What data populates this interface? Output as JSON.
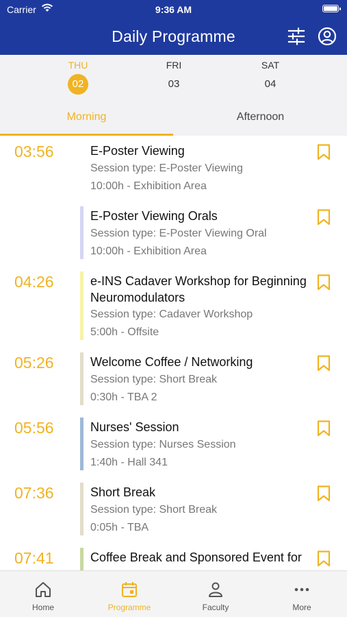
{
  "status_bar": {
    "carrier": "Carrier",
    "time": "9:36 AM"
  },
  "header": {
    "title": "Daily Programme",
    "filter_icon": "sliders-icon",
    "profile_icon": "user-circle-icon"
  },
  "colors": {
    "header": "#1f3a9e",
    "accent": "#f0b323",
    "grey_bg": "#f2f2f4"
  },
  "days": [
    {
      "name": "THU",
      "number": "02",
      "active": true
    },
    {
      "name": "FRI",
      "number": "03",
      "active": false
    },
    {
      "name": "SAT",
      "number": "04",
      "active": false
    }
  ],
  "tabs": [
    {
      "label": "Morning",
      "active": true
    },
    {
      "label": "Afternoon",
      "active": false
    }
  ],
  "sessions": [
    {
      "time": "03:56",
      "title": "E-Poster Viewing",
      "type": "Session type: E-Poster Viewing",
      "detail": "10:00h - Exhibition Area",
      "color": ""
    },
    {
      "time": "",
      "title": "E-Poster Viewing Orals",
      "type": "Session type: E-Poster Viewing Oral",
      "detail": "10:00h - Exhibition Area",
      "color": "#d5d5f5"
    },
    {
      "time": "04:26",
      "title": "e-INS Cadaver Workshop for Beginning Neuromodulators",
      "type": "Session type: Cadaver Workshop",
      "detail": "5:00h - Offsite",
      "color": "#f7f3a8"
    },
    {
      "time": "05:26",
      "title": "Welcome Coffee / Networking",
      "type": "Session type: Short Break",
      "detail": "0:30h - TBA 2",
      "color": "#e2dcc8"
    },
    {
      "time": "05:56",
      "title": "Nurses' Session",
      "type": "Session type: Nurses Session",
      "detail": "1:40h - Hall 341",
      "color": "#9db8d8"
    },
    {
      "time": "07:36",
      "title": "Short Break",
      "type": "Session type: Short Break",
      "detail": "0:05h - TBA",
      "color": "#e2dcc8"
    },
    {
      "time": "07:41",
      "title": "Coffee Break and Sponsored Event for",
      "type": "",
      "detail": "",
      "color": "#c8d8a0"
    }
  ],
  "bottom_nav": [
    {
      "label": "Home",
      "icon": "home-icon",
      "active": false
    },
    {
      "label": "Programme",
      "icon": "calendar-icon",
      "active": true
    },
    {
      "label": "Faculty",
      "icon": "person-icon",
      "active": false
    },
    {
      "label": "More",
      "icon": "more-dots-icon",
      "active": false
    }
  ]
}
